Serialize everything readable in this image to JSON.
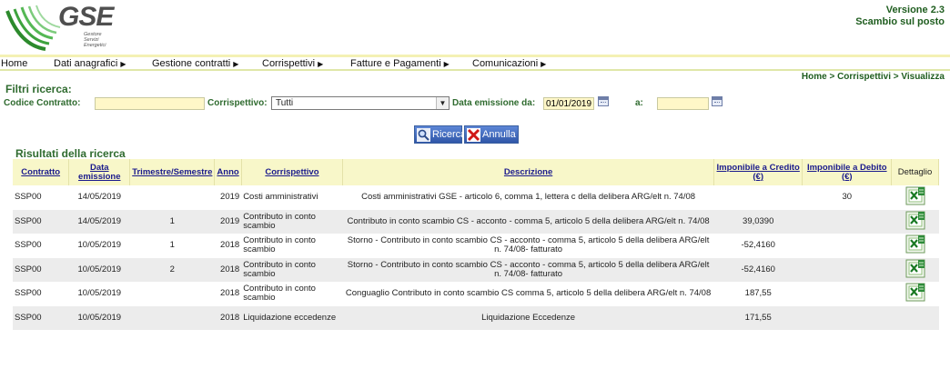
{
  "header": {
    "logo_text": "GSE",
    "logo_sub_1": "Gestore",
    "logo_sub_2": "Servizi",
    "logo_sub_3": "Energetici",
    "version": "Versione 2.3",
    "subtitle": "Scambio sul posto"
  },
  "menu": [
    {
      "label": "Home",
      "arrow": ""
    },
    {
      "label": "Dati anagrafici",
      "arrow": "▶"
    },
    {
      "label": "Gestione contratti",
      "arrow": "▶"
    },
    {
      "label": "Corrispettivi",
      "arrow": "▶"
    },
    {
      "label": "Fatture e Pagamenti",
      "arrow": "▶"
    },
    {
      "label": "Comunicazioni",
      "arrow": "▶"
    }
  ],
  "breadcrumb": "Home > Corrispettivi > Visualizza",
  "filters": {
    "title": "Filtri ricerca:",
    "codice_label": "Codice Contratto:",
    "codice_value": "",
    "corrispettivo_label": "Corrispettivo:",
    "corrispettivo_selected": "Tutti",
    "data_da_label": "Data emissione da:",
    "data_da_value": "01/01/2019",
    "a_label": "a:",
    "a_value": ""
  },
  "buttons": {
    "search_label": "Ricerca",
    "cancel_label": "Annulla"
  },
  "results": {
    "title": "Risultati della ricerca",
    "columns": [
      "Contratto",
      "Data emissione",
      "Trimestre/Semestre",
      "Anno",
      "Corrispettivo",
      "Descrizione",
      "Imponibile a Credito (€)",
      "Imponibile a Debito (€)",
      "Dettaglio"
    ],
    "rows": [
      {
        "contratto": "SSP00",
        "data": "14/05/2019",
        "trimestre": "",
        "anno": "2019",
        "corrispettivo": "Costi amministrativi",
        "descrizione": "Costi amministrativi GSE - articolo 6, comma 1, lettera c della delibera ARG/elt n. 74/08",
        "credito": "",
        "debito": "30",
        "dettaglio": true
      },
      {
        "contratto": "SSP00",
        "data": "14/05/2019",
        "trimestre": "1",
        "anno": "2019",
        "corrispettivo": "Contributo in conto scambio",
        "descrizione": "Contributo in conto scambio CS - acconto - comma 5, articolo 5 della delibera ARG/elt n. 74/08",
        "credito": "39,0390",
        "debito": "",
        "dettaglio": true
      },
      {
        "contratto": "SSP00",
        "data": "10/05/2019",
        "trimestre": "1",
        "anno": "2018",
        "corrispettivo": "Contributo in conto scambio",
        "descrizione": "Storno - Contributo in conto scambio CS - acconto - comma 5, articolo 5 della delibera ARG/elt n. 74/08- fatturato",
        "credito": "-52,4160",
        "debito": "",
        "dettaglio": true
      },
      {
        "contratto": "SSP00",
        "data": "10/05/2019",
        "trimestre": "2",
        "anno": "2018",
        "corrispettivo": "Contributo in conto scambio",
        "descrizione": "Storno - Contributo in conto scambio CS - acconto - comma 5, articolo 5 della delibera ARG/elt n. 74/08- fatturato",
        "credito": "-52,4160",
        "debito": "",
        "dettaglio": true
      },
      {
        "contratto": "SSP00",
        "data": "10/05/2019",
        "trimestre": "",
        "anno": "2018",
        "corrispettivo": "Contributo in conto scambio",
        "descrizione": "Conguaglio Contributo in conto scambio CS comma 5, articolo 5 della delibera ARG/elt n. 74/08",
        "credito": "187,55",
        "debito": "",
        "dettaglio": true
      },
      {
        "contratto": "SSP00",
        "data": "10/05/2019",
        "trimestre": "",
        "anno": "2018",
        "corrispettivo": "Liquidazione eccedenze",
        "descrizione": "Liquidazione Eccedenze",
        "credito": "171,55",
        "debito": "",
        "dettaglio": false
      }
    ]
  },
  "colors": {
    "accent_green": "#2f6b2f",
    "header_bar": "#f4f1b4",
    "table_header_bg": "#f8f7c9",
    "link_blue": "#1a1a8c"
  }
}
